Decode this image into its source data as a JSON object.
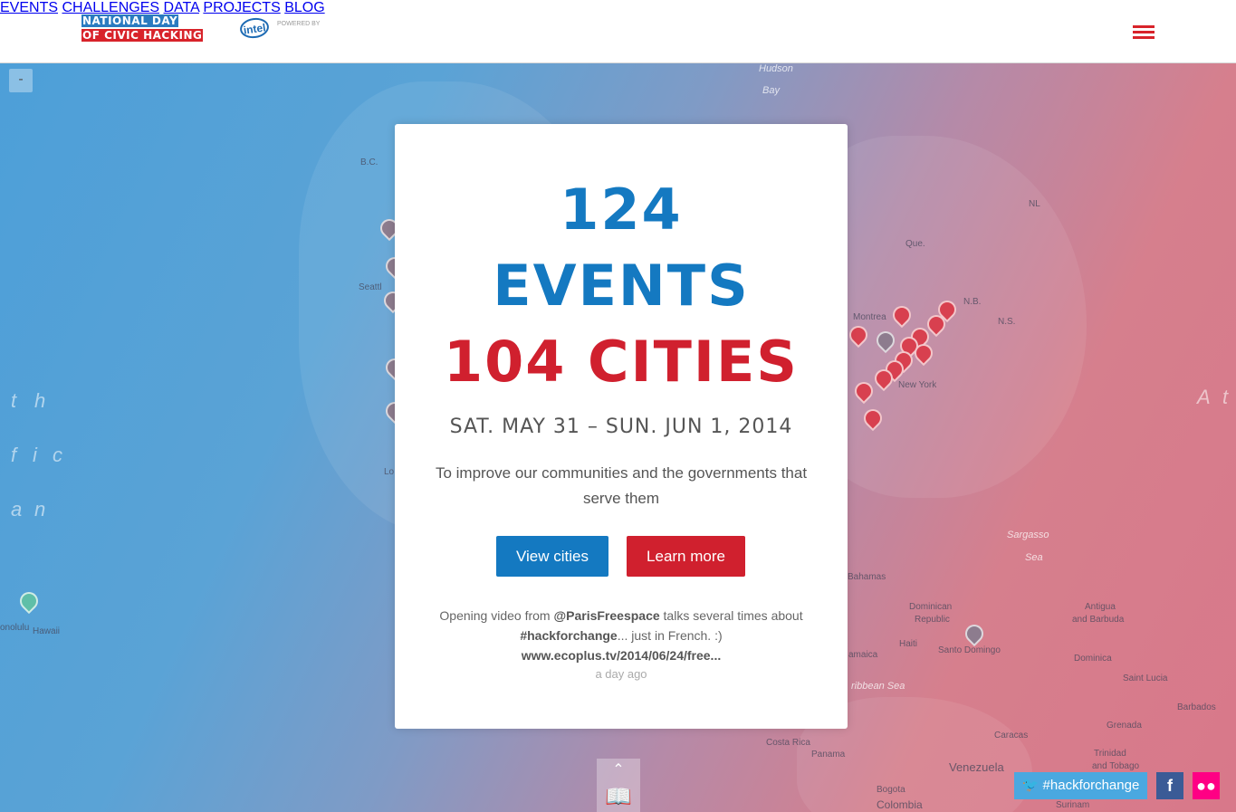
{
  "header": {
    "logo_line1": "NATIONAL DAY",
    "logo_line2": "OF CIVIC HACKING",
    "sponsor_mark": "intel",
    "sponsor_caption": "POWERED BY",
    "nav": [
      "EVENTS",
      "CHALLENGES",
      "DATA",
      "PROJECTS",
      "BLOG"
    ],
    "menu_icon": "hamburger-icon"
  },
  "map": {
    "zoom_label": "-",
    "labels": [
      "Hudson",
      "Bay",
      "B.C.",
      "Seattl",
      "Lo",
      "Que.",
      "Montrea",
      "N.B.",
      "N.S.",
      "NL",
      "New York",
      "Sargasso",
      "Sea",
      "Bahamas",
      "Dominican",
      "Republic",
      "Haiti",
      "Santo Domingo",
      "amaica",
      "ribbean Sea",
      "Antigua",
      "and Barbuda",
      "Dominica",
      "Saint Lucia",
      "Barbados",
      "Grenada",
      "Trinidad",
      "and Tobago",
      "Costa Rica",
      "Panama",
      "Caracas",
      "Venezuela",
      "Bogota",
      "Colombia",
      "Surinam",
      "onolulu",
      "Hawaii"
    ],
    "ocean_letters": [
      "t",
      "h",
      "f",
      "i",
      "c",
      "a",
      "n",
      "A",
      "t"
    ]
  },
  "card": {
    "events_count": "124",
    "events_label": "EVENTS",
    "cities_label": "104 CITIES",
    "dates": "SAT. MAY 31 – SUN. JUN 1, 2014",
    "tagline": "To improve our communities and the governments that serve them",
    "view_cities": "View cities",
    "learn_more": "Learn more",
    "tweet_prefix": "Opening video from ",
    "tweet_handle": "@ParisFreespace",
    "tweet_mid": " talks several times about ",
    "tweet_tag": "#hackforchange",
    "tweet_suffix": "... just in French. :)",
    "tweet_link": "www.ecoplus.tv/2014/06/24/free...",
    "tweet_time": "a day ago"
  },
  "bottom_tab": {
    "chevron_icon": "chevron-up-icon",
    "map_icon": "map-icon"
  },
  "social": {
    "twitter_label": "#hackforchange",
    "facebook_label": "f",
    "flickr_label": "●●"
  },
  "colors": {
    "blue": "#1479c1",
    "red": "#d0202e"
  }
}
